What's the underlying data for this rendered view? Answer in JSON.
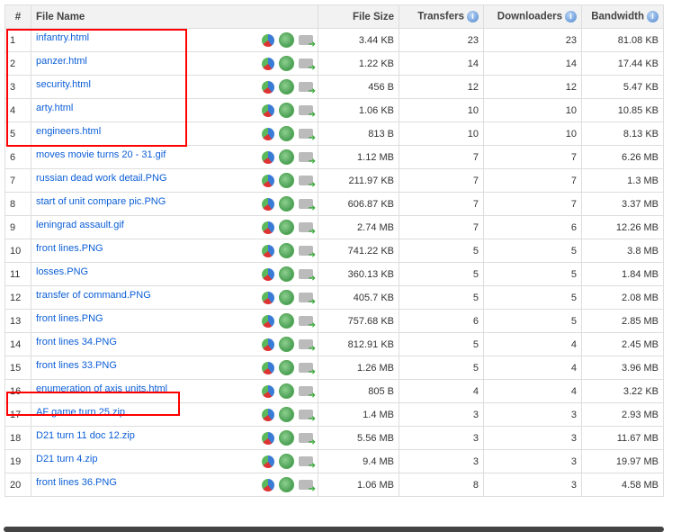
{
  "headers": {
    "num": "#",
    "name": "File Name",
    "size": "File Size",
    "transfers": "Transfers",
    "downloaders": "Downloaders",
    "bandwidth": "Bandwidth"
  },
  "rows": [
    {
      "n": "1",
      "name": "infantry.html",
      "size": "3.44 KB",
      "t": "23",
      "d": "23",
      "b": "81.08 KB"
    },
    {
      "n": "2",
      "name": "panzer.html",
      "size": "1.22 KB",
      "t": "14",
      "d": "14",
      "b": "17.44 KB"
    },
    {
      "n": "3",
      "name": "security.html",
      "size": "456 B",
      "t": "12",
      "d": "12",
      "b": "5.47 KB"
    },
    {
      "n": "4",
      "name": "arty.html",
      "size": "1.06 KB",
      "t": "10",
      "d": "10",
      "b": "10.85 KB"
    },
    {
      "n": "5",
      "name": "engineers.html",
      "size": "813 B",
      "t": "10",
      "d": "10",
      "b": "8.13 KB"
    },
    {
      "n": "6",
      "name": "moves movie turns 20 - 31.gif",
      "size": "1.12 MB",
      "t": "7",
      "d": "7",
      "b": "6.26 MB"
    },
    {
      "n": "7",
      "name": "russian dead work detail.PNG",
      "size": "211.97 KB",
      "t": "7",
      "d": "7",
      "b": "1.3 MB"
    },
    {
      "n": "8",
      "name": "start of unit compare pic.PNG",
      "size": "606.87 KB",
      "t": "7",
      "d": "7",
      "b": "3.37 MB"
    },
    {
      "n": "9",
      "name": "leningrad assault.gif",
      "size": "2.74 MB",
      "t": "7",
      "d": "6",
      "b": "12.26 MB"
    },
    {
      "n": "10",
      "name": "front lines.PNG",
      "size": "741.22 KB",
      "t": "5",
      "d": "5",
      "b": "3.8 MB"
    },
    {
      "n": "11",
      "name": "losses.PNG",
      "size": "360.13 KB",
      "t": "5",
      "d": "5",
      "b": "1.84 MB"
    },
    {
      "n": "12",
      "name": "transfer of command.PNG",
      "size": "405.7 KB",
      "t": "5",
      "d": "5",
      "b": "2.08 MB"
    },
    {
      "n": "13",
      "name": "front lines.PNG",
      "size": "757.68 KB",
      "t": "6",
      "d": "5",
      "b": "2.85 MB"
    },
    {
      "n": "14",
      "name": "front lines 34.PNG",
      "size": "812.91 KB",
      "t": "5",
      "d": "4",
      "b": "2.45 MB"
    },
    {
      "n": "15",
      "name": "front lines 33.PNG",
      "size": "1.26 MB",
      "t": "5",
      "d": "4",
      "b": "3.96 MB"
    },
    {
      "n": "16",
      "name": "enumeration of axis units.html",
      "size": "805 B",
      "t": "4",
      "d": "4",
      "b": "3.22 KB"
    },
    {
      "n": "17",
      "name": "AF game turn 25.zip",
      "size": "1.4 MB",
      "t": "3",
      "d": "3",
      "b": "2.93 MB"
    },
    {
      "n": "18",
      "name": "D21 turn 11 doc 12.zip",
      "size": "5.56 MB",
      "t": "3",
      "d": "3",
      "b": "11.67 MB"
    },
    {
      "n": "19",
      "name": "D21 turn 4.zip",
      "size": "9.4 MB",
      "t": "3",
      "d": "3",
      "b": "19.97 MB"
    },
    {
      "n": "20",
      "name": "front lines 36.PNG",
      "size": "1.06 MB",
      "t": "8",
      "d": "3",
      "b": "4.58 MB"
    }
  ]
}
